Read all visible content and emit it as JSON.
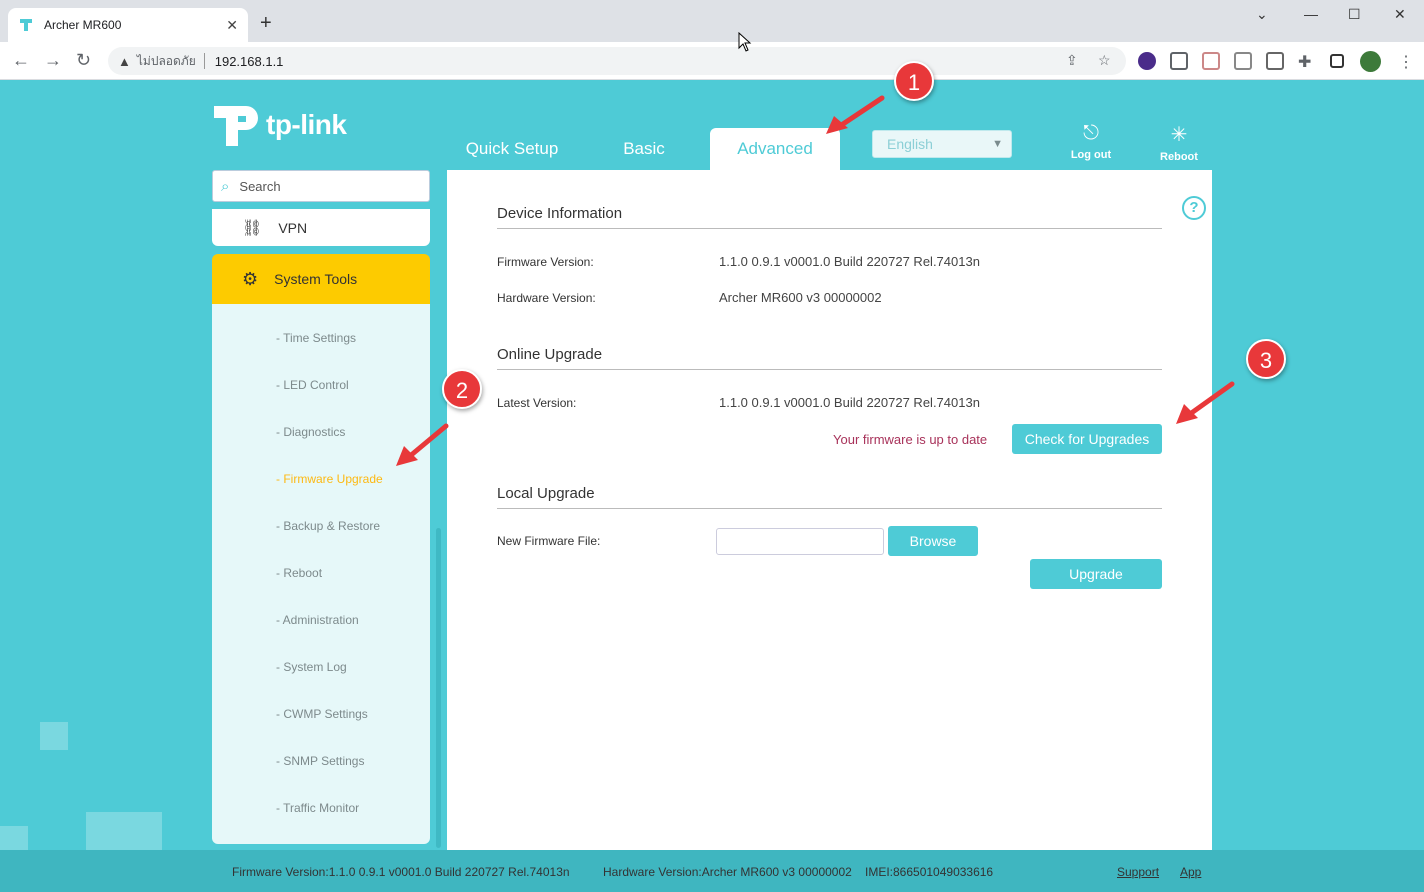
{
  "browser": {
    "tab_title": "Archer MR600",
    "insecure_label": "ไม่ปลอดภัย",
    "url": "192.168.1.1"
  },
  "brand": {
    "logo_text": "tp-link"
  },
  "nav": {
    "tabs": [
      {
        "label": "Quick Setup"
      },
      {
        "label": "Basic"
      },
      {
        "label": "Advanced"
      }
    ],
    "language": "English",
    "logout": "Log out",
    "reboot": "Reboot"
  },
  "sidebar": {
    "search_placeholder": "Search",
    "vpn": "VPN",
    "system_tools": "System Tools",
    "items": [
      {
        "label": "- Time Settings"
      },
      {
        "label": "- LED Control"
      },
      {
        "label": "- Diagnostics"
      },
      {
        "label": "- Firmware Upgrade"
      },
      {
        "label": "- Backup & Restore"
      },
      {
        "label": "- Reboot"
      },
      {
        "label": "- Administration"
      },
      {
        "label": "- System Log"
      },
      {
        "label": "- CWMP Settings"
      },
      {
        "label": "- SNMP Settings"
      },
      {
        "label": "- Traffic Monitor"
      }
    ]
  },
  "content": {
    "device_info": {
      "title": "Device Information",
      "firmware_label": "Firmware Version:",
      "firmware_value": "1.1.0 0.9.1 v0001.0 Build 220727 Rel.74013n",
      "hardware_label": "Hardware Version:",
      "hardware_value": "Archer MR600 v3 00000002"
    },
    "online_upgrade": {
      "title": "Online Upgrade",
      "latest_label": "Latest Version:",
      "latest_value": "1.1.0 0.9.1 v0001.0 Build 220727 Rel.74013n",
      "status": "Your firmware is up to date",
      "check_button": "Check for Upgrades"
    },
    "local_upgrade": {
      "title": "Local Upgrade",
      "file_label": "New Firmware File:",
      "browse_button": "Browse",
      "upgrade_button": "Upgrade"
    }
  },
  "footer": {
    "firmware": "Firmware Version:1.1.0 0.9.1 v0001.0 Build 220727 Rel.74013n",
    "hardware": "Hardware Version:Archer MR600 v3 00000002",
    "imei": "IMEI:866501049033616",
    "support": "Support",
    "app": "App"
  },
  "annotations": {
    "badge1": "1",
    "badge2": "2",
    "badge3": "3"
  },
  "colors": {
    "accent": "#4ecbd6",
    "highlight": "#fdcb00",
    "annotation": "#e8383a"
  }
}
